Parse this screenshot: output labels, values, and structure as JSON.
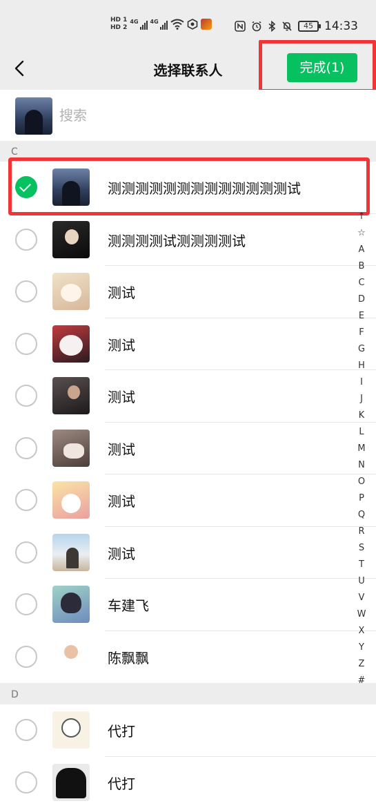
{
  "status_bar": {
    "sim1": "HD 1",
    "sim2": "HD 2",
    "net1": "4G",
    "net2": "4G",
    "battery": "45",
    "time": "14:33"
  },
  "nav": {
    "back_icon": "chevron-left-icon",
    "title": "选择联系人",
    "done_label": "完成(1)"
  },
  "search": {
    "placeholder": "搜索"
  },
  "sections": [
    {
      "letter": "C",
      "contacts": [
        {
          "name": "测测测测测测测测测测测测测试",
          "checked": true
        },
        {
          "name": "测测测测试测测测测试",
          "checked": false
        },
        {
          "name": "测试",
          "checked": false
        },
        {
          "name": "测试",
          "checked": false
        },
        {
          "name": "测试",
          "checked": false
        },
        {
          "name": "测试",
          "checked": false
        },
        {
          "name": "测试",
          "checked": false
        },
        {
          "name": "测试",
          "checked": false
        },
        {
          "name": "车建飞",
          "checked": false
        },
        {
          "name": "陈飘飘",
          "checked": false
        }
      ]
    },
    {
      "letter": "D",
      "contacts": [
        {
          "name": "代打",
          "checked": false
        },
        {
          "name": "代打",
          "checked": false
        }
      ]
    }
  ],
  "index_bar": [
    "↑",
    "☆",
    "A",
    "B",
    "C",
    "D",
    "E",
    "F",
    "G",
    "H",
    "I",
    "J",
    "K",
    "L",
    "M",
    "N",
    "O",
    "P",
    "Q",
    "R",
    "S",
    "T",
    "U",
    "V",
    "W",
    "X",
    "Y",
    "Z",
    "#"
  ],
  "colors": {
    "accent": "#07c160",
    "highlight": "#f03438",
    "background": "#ededed"
  }
}
